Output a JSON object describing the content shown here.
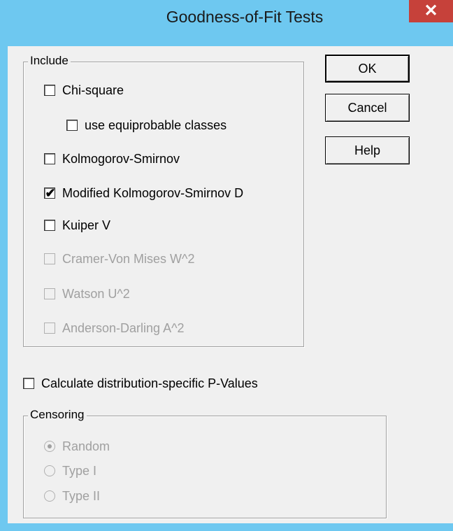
{
  "window": {
    "title": "Goodness-of-Fit Tests",
    "close_glyph": "✕"
  },
  "include_group": {
    "label": "Include",
    "options": [
      {
        "label": "Chi-square",
        "checked": false,
        "enabled": true
      },
      {
        "label": "use equiprobable classes",
        "checked": false,
        "enabled": true
      },
      {
        "label": "Kolmogorov-Smirnov",
        "checked": false,
        "enabled": true
      },
      {
        "label": "Modified Kolmogorov-Smirnov D",
        "checked": true,
        "enabled": true
      },
      {
        "label": "Kuiper V",
        "checked": false,
        "enabled": true
      },
      {
        "label": "Cramer-Von Mises W^2",
        "checked": false,
        "enabled": false
      },
      {
        "label": "Watson U^2",
        "checked": false,
        "enabled": false
      },
      {
        "label": "Anderson-Darling A^2",
        "checked": false,
        "enabled": false
      }
    ]
  },
  "pvalues_option": {
    "label": "Calculate distribution-specific P-Values",
    "checked": false,
    "enabled": true
  },
  "censoring_group": {
    "label": "Censoring",
    "options": [
      {
        "label": "Random",
        "selected": true,
        "enabled": false
      },
      {
        "label": "Type I",
        "selected": false,
        "enabled": false
      },
      {
        "label": "Type II",
        "selected": false,
        "enabled": false
      }
    ]
  },
  "buttons": {
    "ok": "OK",
    "cancel": "Cancel",
    "help": "Help"
  },
  "colors": {
    "titlebar": "#6ec8f0",
    "close": "#c6413a",
    "dialog_bg": "#f0f0f0",
    "disabled_text": "#a0a0a0"
  },
  "icons": {
    "checkmark": "✔",
    "close": "close-icon"
  }
}
